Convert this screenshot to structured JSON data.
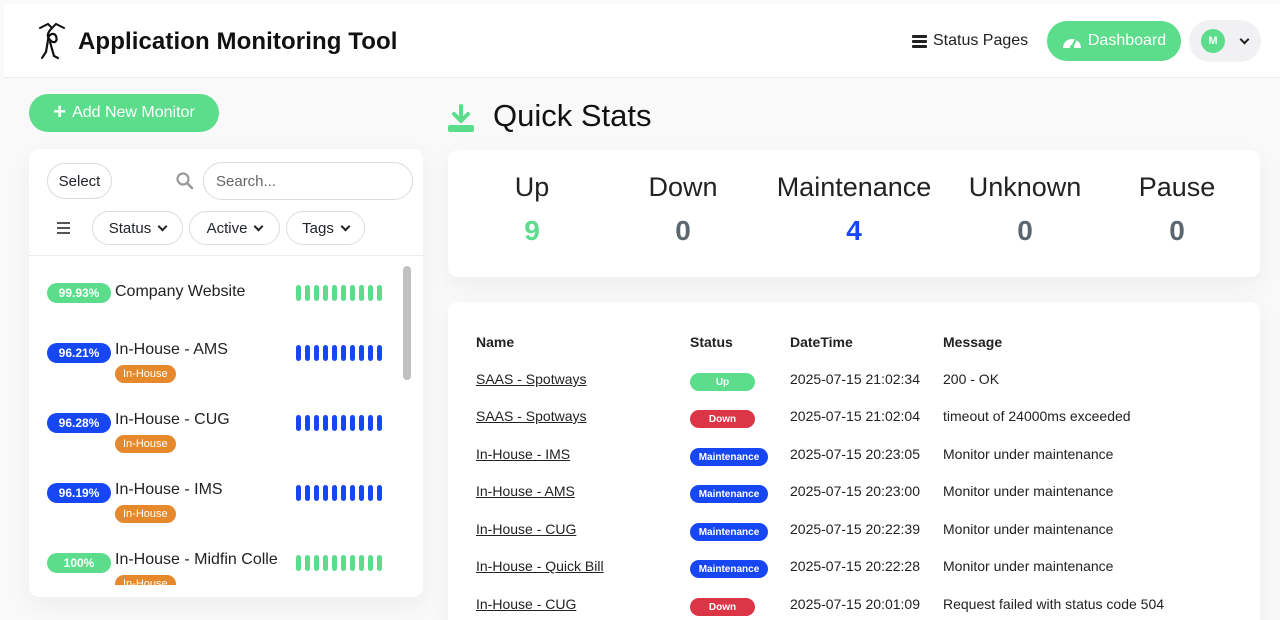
{
  "header": {
    "title": "Application Monitoring Tool",
    "logo_icon": "uptime-kuma-logo",
    "status_pages_label": "Status Pages",
    "dashboard_label": "Dashboard",
    "avatar_initial": "M"
  },
  "sidebar": {
    "add_label": "Add New Monitor",
    "select_label": "Select",
    "search_placeholder": "Search...",
    "filters": [
      "Status",
      "Active",
      "Tags"
    ],
    "monitors": [
      {
        "uptime": "99.93%",
        "name": "Company Website",
        "tag": "",
        "status": "up"
      },
      {
        "uptime": "96.21%",
        "name": "In-House - AMS",
        "tag": "In-House",
        "status": "maintenance"
      },
      {
        "uptime": "96.28%",
        "name": "In-House - CUG",
        "tag": "In-House",
        "status": "maintenance"
      },
      {
        "uptime": "96.19%",
        "name": "In-House - IMS",
        "tag": "In-House",
        "status": "maintenance"
      },
      {
        "uptime": "100%",
        "name": "In-House - Midfin Collections",
        "tag": "In-House",
        "status": "up"
      }
    ]
  },
  "quick_stats": {
    "title": "Quick Stats",
    "items": [
      {
        "label": "Up",
        "value": "9",
        "color": "#5cdd8b"
      },
      {
        "label": "Down",
        "value": "0",
        "color": "#5c6670"
      },
      {
        "label": "Maintenance",
        "value": "4",
        "color": "#1747f5"
      },
      {
        "label": "Unknown",
        "value": "0",
        "color": "#5c6670"
      },
      {
        "label": "Pause",
        "value": "0",
        "color": "#5c6670"
      }
    ]
  },
  "events": {
    "headers": [
      "Name",
      "Status",
      "DateTime",
      "Message"
    ],
    "rows": [
      {
        "name": "SAAS - Spotways",
        "status": "Up",
        "datetime": "2025-07-15 21:02:34",
        "message": "200 - OK"
      },
      {
        "name": "SAAS - Spotways",
        "status": "Down",
        "datetime": "2025-07-15 21:02:04",
        "message": "timeout of 24000ms exceeded"
      },
      {
        "name": "In-House - IMS",
        "status": "Maintenance",
        "datetime": "2025-07-15 20:23:05",
        "message": "Monitor under maintenance"
      },
      {
        "name": "In-House - AMS",
        "status": "Maintenance",
        "datetime": "2025-07-15 20:23:00",
        "message": "Monitor under maintenance"
      },
      {
        "name": "In-House - CUG",
        "status": "Maintenance",
        "datetime": "2025-07-15 20:22:39",
        "message": "Monitor under maintenance"
      },
      {
        "name": "In-House - Quick Bill",
        "status": "Maintenance",
        "datetime": "2025-07-15 20:22:28",
        "message": "Monitor under maintenance"
      },
      {
        "name": "In-House - CUG",
        "status": "Down",
        "datetime": "2025-07-15 20:01:09",
        "message": "Request failed with status code 504"
      }
    ]
  },
  "colors": {
    "up": "#5cdd8b",
    "down": "#dc3545",
    "maintenance": "#1747f5",
    "tag": "#e6892c"
  }
}
